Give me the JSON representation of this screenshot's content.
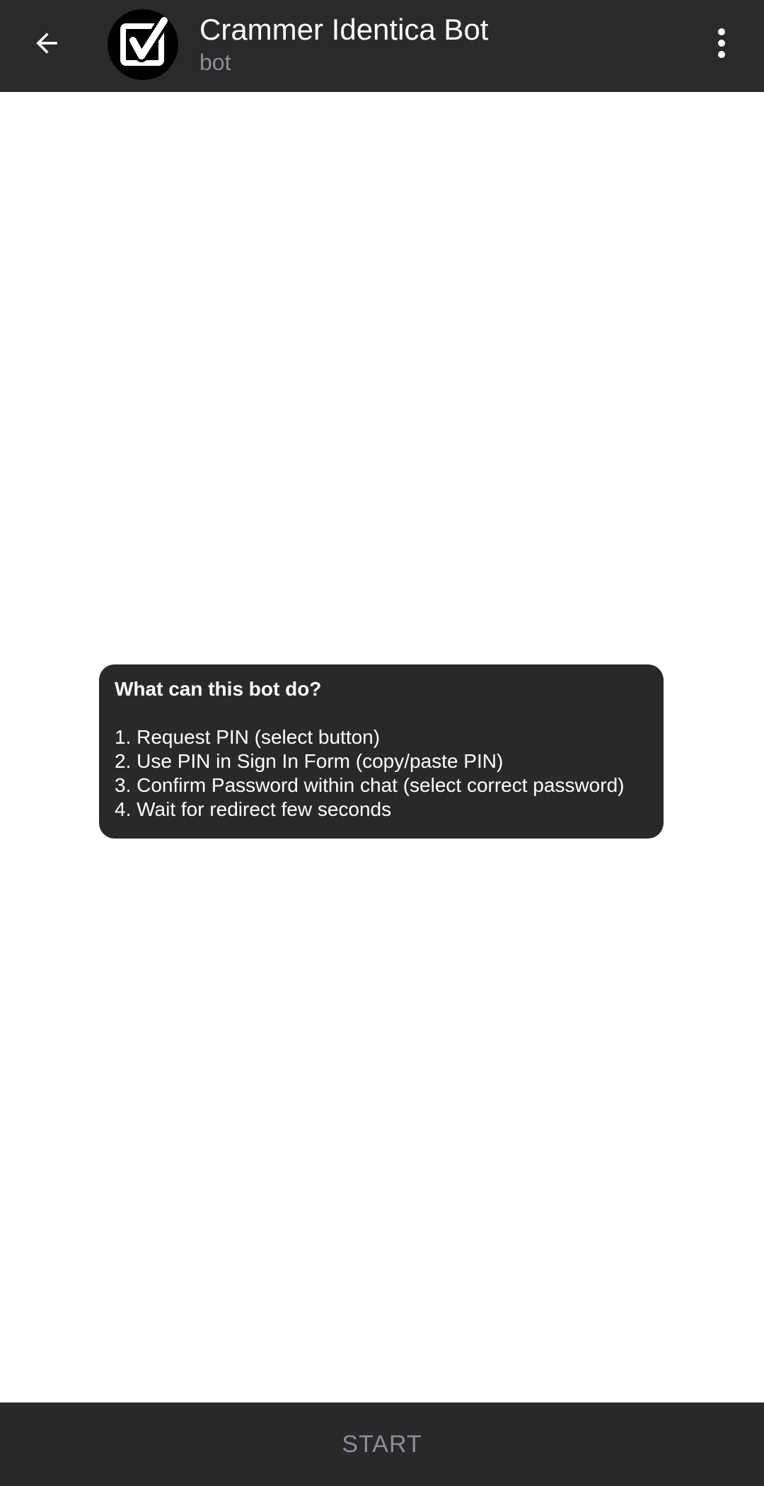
{
  "header": {
    "title": "Crammer Identica Bot",
    "subtitle": "bot",
    "back_icon": "arrow-left-icon",
    "menu_icon": "more-vertical-icon",
    "avatar_icon": "checkbox-checked-icon"
  },
  "info": {
    "title": "What can this bot do?",
    "lines": [
      "1. Request PIN (select button)",
      "2. Use PIN in Sign In Form (copy/paste PIN)",
      "3. Confirm Password within chat (select correct password)",
      "4. Wait for redirect few seconds"
    ]
  },
  "bottom": {
    "start_label": "START"
  },
  "colors": {
    "header_bg": "#2a2a2c",
    "bubble_bg": "#29292c",
    "muted_text": "#8e8e93"
  }
}
